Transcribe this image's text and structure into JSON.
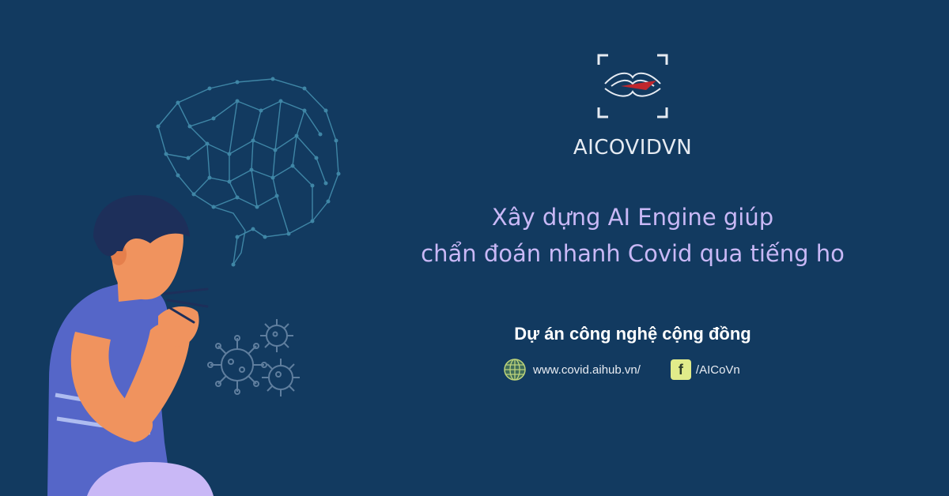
{
  "banner": {
    "brand_name": "AICOVIDVN",
    "headline_line1": "Xây dựng AI Engine giúp",
    "headline_line2": "chẩn đoán nhanh Covid qua tiếng ho",
    "subtitle": "Dự án công nghệ cộng đồng",
    "website_url": "www.covid.aihub.vn/",
    "facebook_handle": "/AICoVn",
    "facebook_letter": "f"
  },
  "colors": {
    "background": "#123a60",
    "headline": "#c9b8f6",
    "facebook_badge": "#e1ec8a",
    "logo_accent": "#c0272d"
  },
  "icons": [
    "globe-icon",
    "facebook-icon",
    "brain-network-icon",
    "virus-icon",
    "logo-waves-icon"
  ]
}
